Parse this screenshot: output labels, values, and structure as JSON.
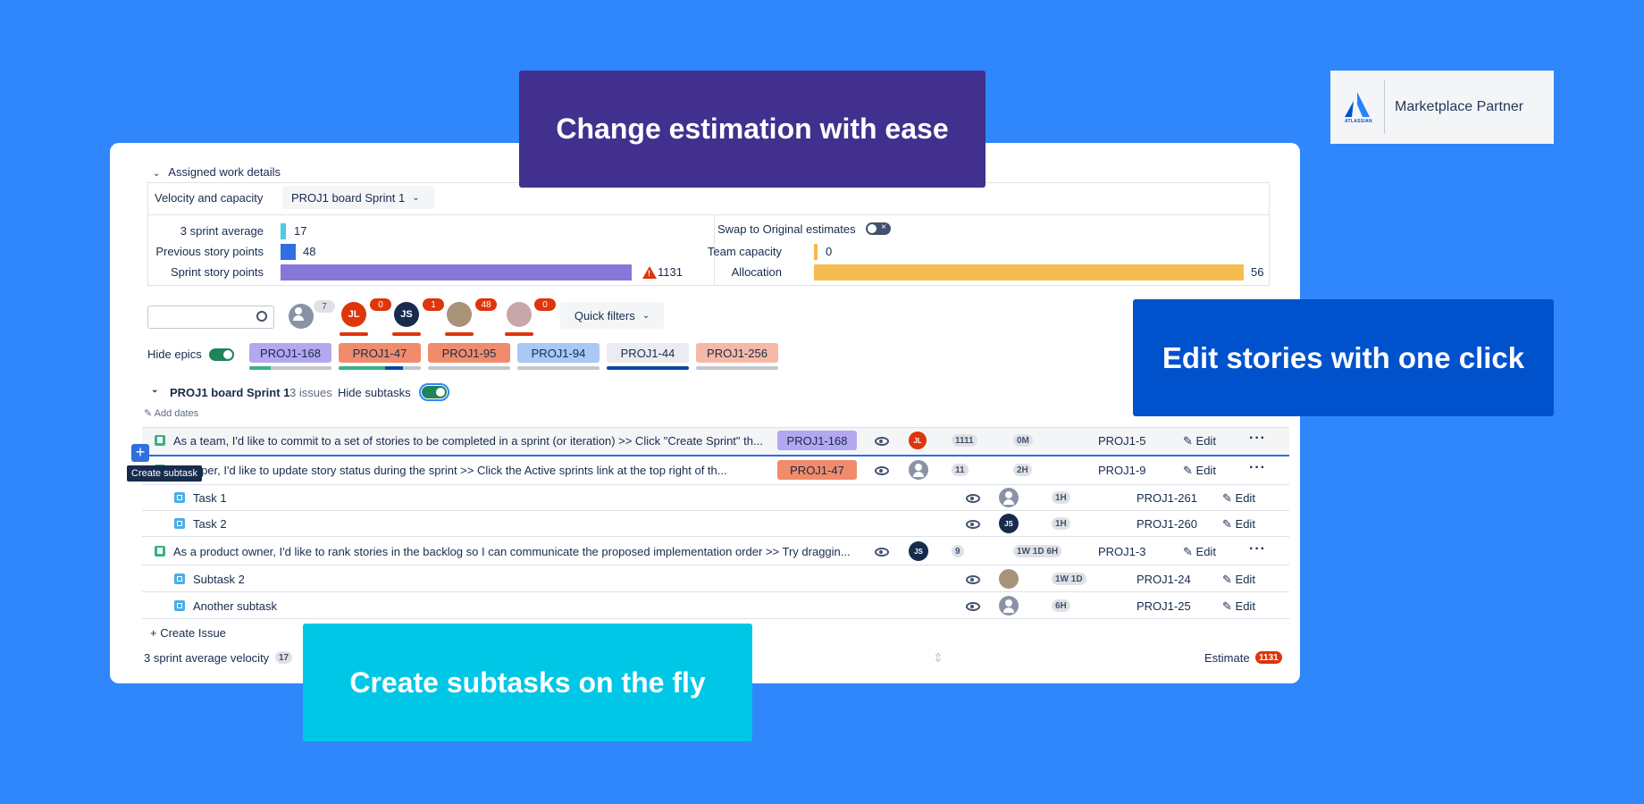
{
  "callouts": {
    "estimation": "Change estimation with ease",
    "edit": "Edit stories with one click",
    "subtasks": "Create subtasks on the fly"
  },
  "partner": {
    "logo_text": "ATLASSIAN",
    "label": "Marketplace Partner"
  },
  "colors": {
    "background": "#2f87fb",
    "estimation_box": "#42308f",
    "edit_box": "#0052cc",
    "subtasks_box": "#00c7e6"
  },
  "work_details": {
    "section_title": "Assigned work details",
    "velocity_label": "Velocity and capacity",
    "sprint_select": "PROJ1 board Sprint 1",
    "metrics": [
      {
        "label": "3 sprint average",
        "value": "17",
        "color": "#4bcde0"
      },
      {
        "label": "Previous story points",
        "value": "48",
        "color": "#2f6fe0"
      },
      {
        "label": "Sprint story points",
        "value": "1131",
        "color": "#8777d9"
      }
    ],
    "swap_label": "Swap to Original estimates",
    "team_capacity_label": "Team capacity",
    "team_capacity_value": "0",
    "allocation_label": "Allocation",
    "allocation_value": "56"
  },
  "filters": {
    "search_placeholder": "",
    "avatars": [
      {
        "initials": "",
        "count": "7"
      },
      {
        "initials": "JL",
        "count": "0"
      },
      {
        "initials": "JS",
        "count": "1"
      },
      {
        "initials": "",
        "count": "48"
      },
      {
        "initials": "",
        "count": "0"
      }
    ],
    "quick_filters": "Quick filters",
    "hide_epics": "Hide epics",
    "epics": [
      "PROJ1-168",
      "PROJ1-47",
      "PROJ1-95",
      "PROJ1-94",
      "PROJ1-44",
      "PROJ1-256"
    ]
  },
  "sprint": {
    "name": "PROJ1 board Sprint 1",
    "issues": "3 issues",
    "hide_subtasks": "Hide subtasks",
    "add_dates": "Add dates",
    "tooltip": "Create subtask",
    "rows": [
      {
        "type": "story",
        "summary": "As a team, I'd like to commit to a set of stories to be completed in a sprint (or iteration) >> Click \"Create Sprint\" th...",
        "epic": "PROJ1-168",
        "assignee": "JL",
        "points": "1111",
        "time": "0M",
        "key": "PROJ1-5",
        "edit": "Edit"
      },
      {
        "type": "story",
        "summary": "eveloper, I'd like to update story status during the sprint >> Click the Active sprints link at the top right of th...",
        "epic": "PROJ1-47",
        "assignee": "",
        "points": "11",
        "time": "2H",
        "key": "PROJ1-9",
        "edit": "Edit"
      },
      {
        "type": "task",
        "summary": "Task 1",
        "assignee": "",
        "time": "1H",
        "key": "PROJ1-261",
        "edit": "Edit"
      },
      {
        "type": "task",
        "summary": "Task 2",
        "assignee": "JS",
        "time": "1H",
        "key": "PROJ1-260",
        "edit": "Edit"
      },
      {
        "type": "story",
        "summary": "As a product owner, I'd like to rank stories in the backlog so I can communicate the proposed implementation order >> Try draggin...",
        "assignee": "JS",
        "points": "9",
        "time": "1W 1D 6H",
        "key": "PROJ1-3",
        "edit": "Edit"
      },
      {
        "type": "task",
        "summary": "Subtask 2",
        "assignee": "",
        "time": "1W 1D",
        "key": "PROJ1-24",
        "edit": "Edit"
      },
      {
        "type": "task",
        "summary": "Another subtask",
        "assignee": "",
        "time": "6H",
        "key": "PROJ1-25",
        "edit": "Edit"
      }
    ],
    "create_issue": "+ Create Issue",
    "footer_velocity_label": "3 sprint average velocity",
    "footer_velocity_value": "17",
    "estimate_label": "Estimate",
    "estimate_value": "1131"
  }
}
